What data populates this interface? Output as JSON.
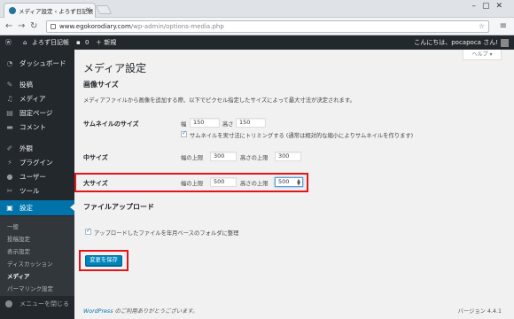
{
  "browser": {
    "tab_title": "メディア設定 ‹ よろず日記帳 —",
    "tab_close": "×",
    "url_host": "www.egokorodiary.com",
    "url_path": "/wp-admin/options-media.php"
  },
  "adminbar": {
    "site_name": "よろず日記帳",
    "comments_count": "0",
    "new_label": "＋ 新規",
    "greeting": "こんにちは、pocapoca さん!"
  },
  "sidebar": {
    "items": [
      {
        "icon": "dashboard-icon",
        "label": "ダッシュボード"
      },
      {
        "icon": "pin-icon",
        "label": "投稿"
      },
      {
        "icon": "media-icon",
        "label": "メディア"
      },
      {
        "icon": "page-icon",
        "label": "固定ページ"
      },
      {
        "icon": "comment-icon",
        "label": "コメント"
      },
      {
        "icon": "appearance-icon",
        "label": "外観"
      },
      {
        "icon": "plugin-icon",
        "label": "プラグイン"
      },
      {
        "icon": "user-icon",
        "label": "ユーザー"
      },
      {
        "icon": "tool-icon",
        "label": "ツール"
      },
      {
        "icon": "settings-icon",
        "label": "設定"
      }
    ],
    "submenu": [
      "一般",
      "投稿設定",
      "表示設定",
      "ディスカッション",
      "メディア",
      "パーマリンク設定"
    ],
    "collapse_label": "メニューを閉じる"
  },
  "main": {
    "help_label": "ヘルプ ▾",
    "page_title": "メディア設定",
    "image_sizes_title": "画像サイズ",
    "image_sizes_desc": "メディアファイルから画像を追加する際、以下でピクセル指定したサイズによって最大寸法が決定されます。",
    "thumbnail": {
      "label": "サムネイルのサイズ",
      "width_label": "幅",
      "width": "150",
      "height_label": "高さ",
      "height": "150",
      "crop_label": "サムネイルを実寸法にトリミングする (通常は相対的な縮小によりサムネイルを作ります)"
    },
    "medium": {
      "label": "中サイズ",
      "max_width_label": "幅の上限",
      "max_width": "300",
      "max_height_label": "高さの上限",
      "max_height": "300"
    },
    "large": {
      "label": "大サイズ",
      "max_width_label": "幅の上限",
      "max_width": "500",
      "max_height_label": "高さの上限",
      "max_height": "500"
    },
    "uploads_title": "ファイルアップロード",
    "uploads_label": "アップロードしたファイルを年月ベースのフォルダに整理",
    "save_label": "変更を保存"
  },
  "footer": {
    "wordpress": "WordPress",
    "thanks": " のご利用ありがとうございます。",
    "version": "バージョン 4.4.1"
  }
}
